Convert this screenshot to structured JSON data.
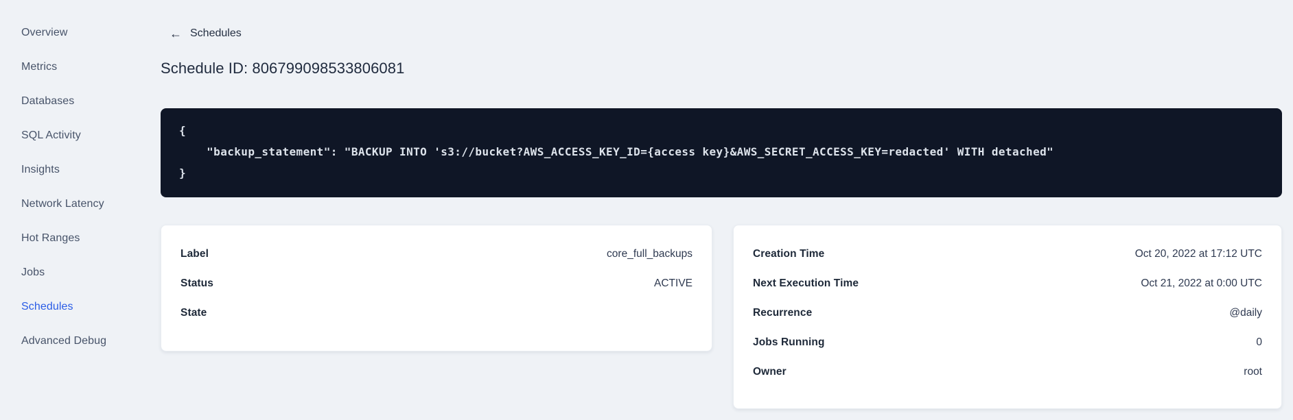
{
  "sidebar": {
    "items": [
      {
        "label": "Overview",
        "active": false
      },
      {
        "label": "Metrics",
        "active": false
      },
      {
        "label": "Databases",
        "active": false
      },
      {
        "label": "SQL Activity",
        "active": false
      },
      {
        "label": "Insights",
        "active": false
      },
      {
        "label": "Network Latency",
        "active": false
      },
      {
        "label": "Hot Ranges",
        "active": false
      },
      {
        "label": "Jobs",
        "active": false
      },
      {
        "label": "Schedules",
        "active": true
      },
      {
        "label": "Advanced Debug",
        "active": false
      }
    ]
  },
  "header": {
    "back_icon_glyph": "←",
    "back_label": "Schedules",
    "title": "Schedule ID: 806799098533806081"
  },
  "code_block": {
    "lines": [
      "{",
      "    \"backup_statement\": \"BACKUP INTO 's3://bucket?AWS_ACCESS_KEY_ID={access key}&AWS_SECRET_ACCESS_KEY=redacted' WITH detached\"",
      "}"
    ]
  },
  "details_left": {
    "rows": [
      {
        "label": "Label",
        "value": "core_full_backups"
      },
      {
        "label": "Status",
        "value": "ACTIVE"
      },
      {
        "label": "State",
        "value": ""
      }
    ]
  },
  "details_right": {
    "rows": [
      {
        "label": "Creation Time",
        "value": "Oct 20, 2022 at 17:12 UTC"
      },
      {
        "label": "Next Execution Time",
        "value": "Oct 21, 2022 at 0:00 UTC"
      },
      {
        "label": "Recurrence",
        "value": "@daily"
      },
      {
        "label": "Jobs Running",
        "value": "0"
      },
      {
        "label": "Owner",
        "value": "root"
      }
    ]
  },
  "colors": {
    "page_background": "#eff2f6",
    "card_background": "#ffffff",
    "code_block_background": "#0f1626",
    "code_text": "#dde3eb",
    "active_nav_blue": "#2a5ce6",
    "text_dark_navy": "#1f2a3d"
  }
}
